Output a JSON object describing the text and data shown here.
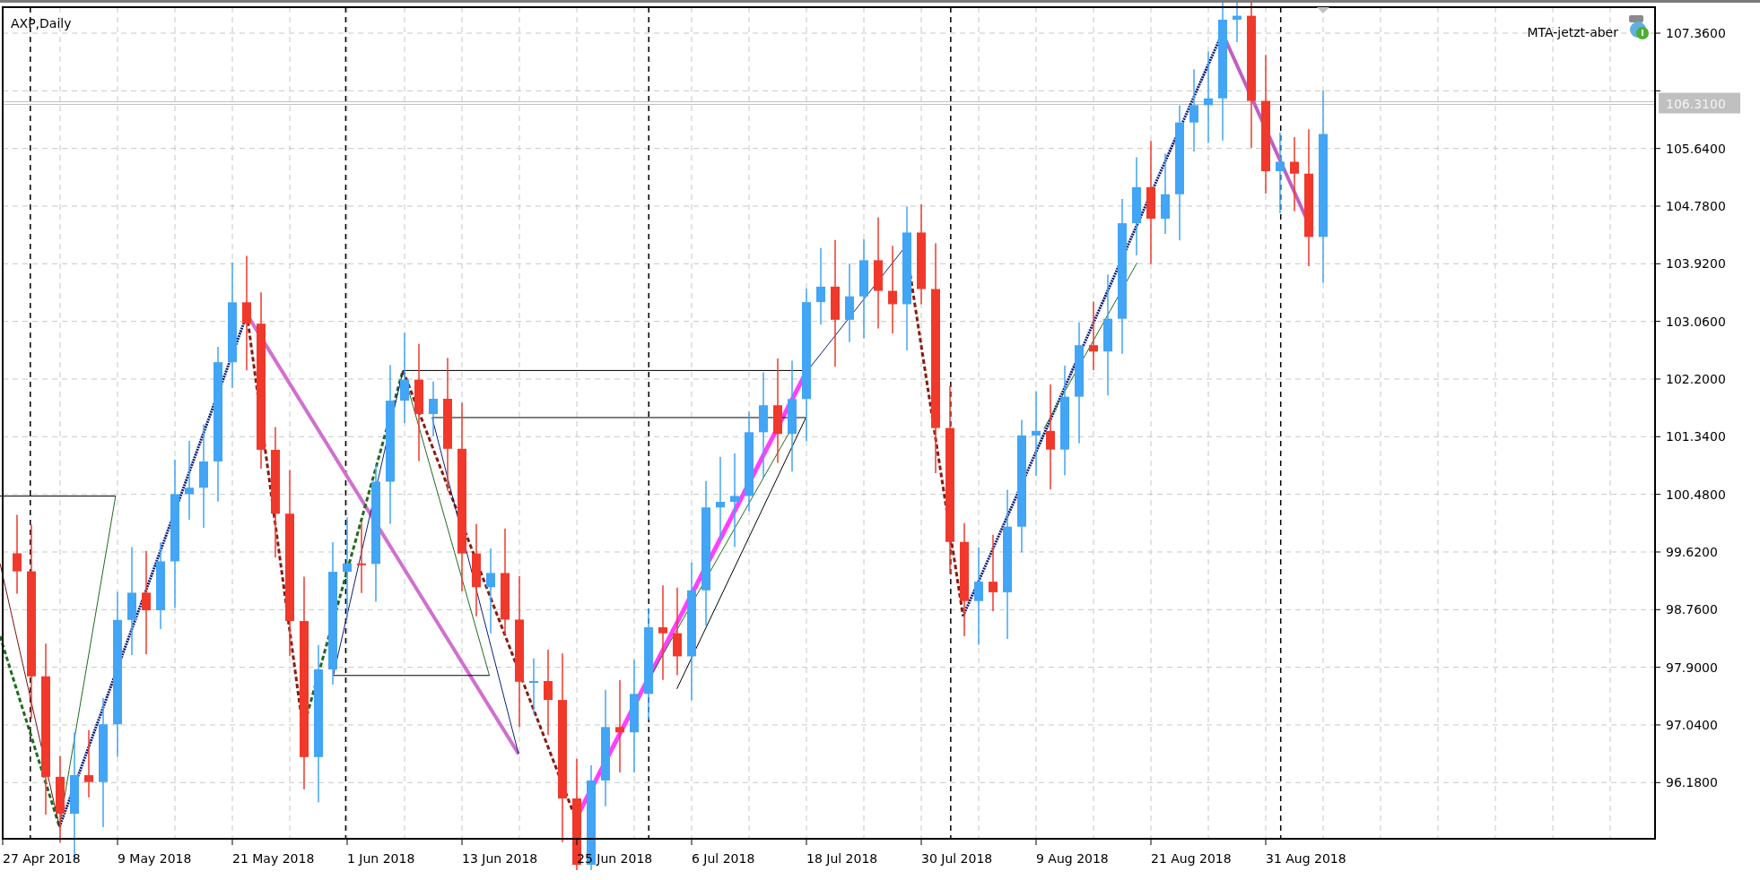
{
  "chart": {
    "symbol_label": "AXP,Daily",
    "indicator_label": "MTA-jetzt-aber",
    "current_price": "106.3100",
    "price_axis": [
      "107.3600",
      "105.6400",
      "104.7800",
      "103.9200",
      "103.0600",
      "102.2000",
      "101.3400",
      "100.4800",
      "99.6200",
      "98.7600",
      "97.9000",
      "97.0400",
      "96.1800"
    ],
    "time_axis": [
      "27 Apr 2018",
      "9 May 2018",
      "21 May 2018",
      "1 Jun 2018",
      "13 Jun 2018",
      "25 Jun 2018",
      "6 Jul 2018",
      "18 Jul 2018",
      "30 Jul 2018",
      "9 Aug 2018",
      "21 Aug 2018",
      "31 Aug 2018"
    ]
  }
}
